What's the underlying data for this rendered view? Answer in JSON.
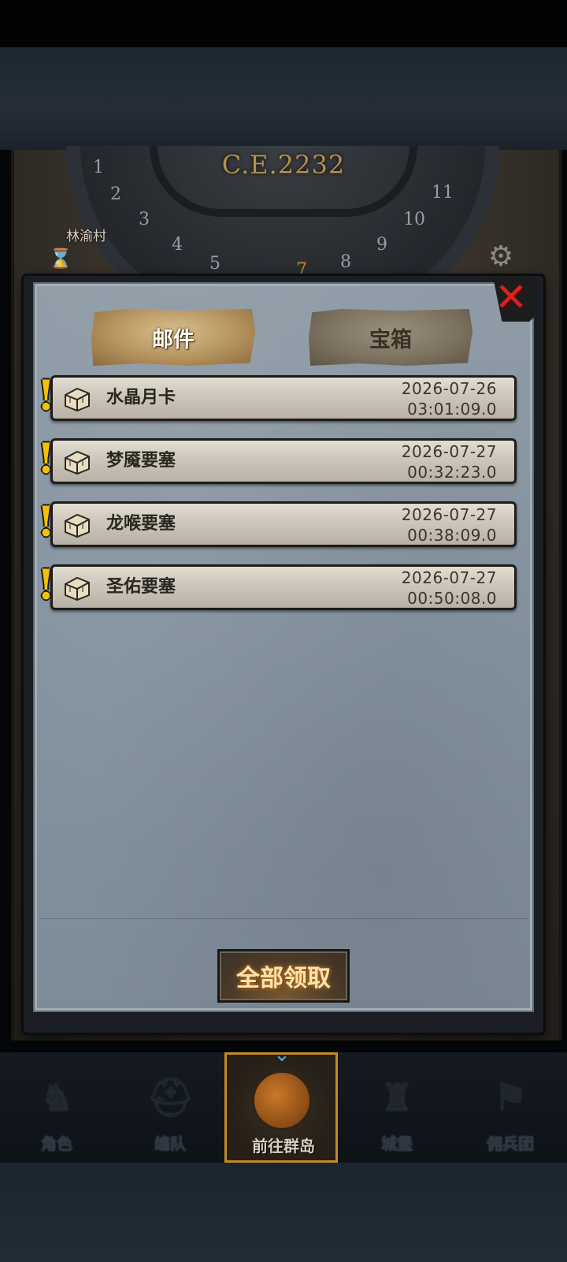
{
  "background": {
    "era": "C.E.2232",
    "village": "林渝村",
    "dial_numbers": [
      "1",
      "2",
      "3",
      "4",
      "5",
      "7",
      "8",
      "9",
      "10",
      "11"
    ]
  },
  "tabs": {
    "mail": "邮件",
    "chest": "宝箱"
  },
  "mail_list": [
    {
      "title": "水晶月卡",
      "date": "2026-07-26",
      "time": "03:01:09.0"
    },
    {
      "title": "梦魇要塞",
      "date": "2026-07-27",
      "time": "00:32:23.0"
    },
    {
      "title": "龙喉要塞",
      "date": "2026-07-27",
      "time": "00:38:09.0"
    },
    {
      "title": "圣佑要塞",
      "date": "2026-07-27",
      "time": "00:50:08.0"
    }
  ],
  "claim_all_label": "全部领取",
  "nav": [
    {
      "label": "角色"
    },
    {
      "label": "编队"
    },
    {
      "label": "前往群岛"
    },
    {
      "label": "城堡"
    },
    {
      "label": "佣兵团"
    }
  ]
}
